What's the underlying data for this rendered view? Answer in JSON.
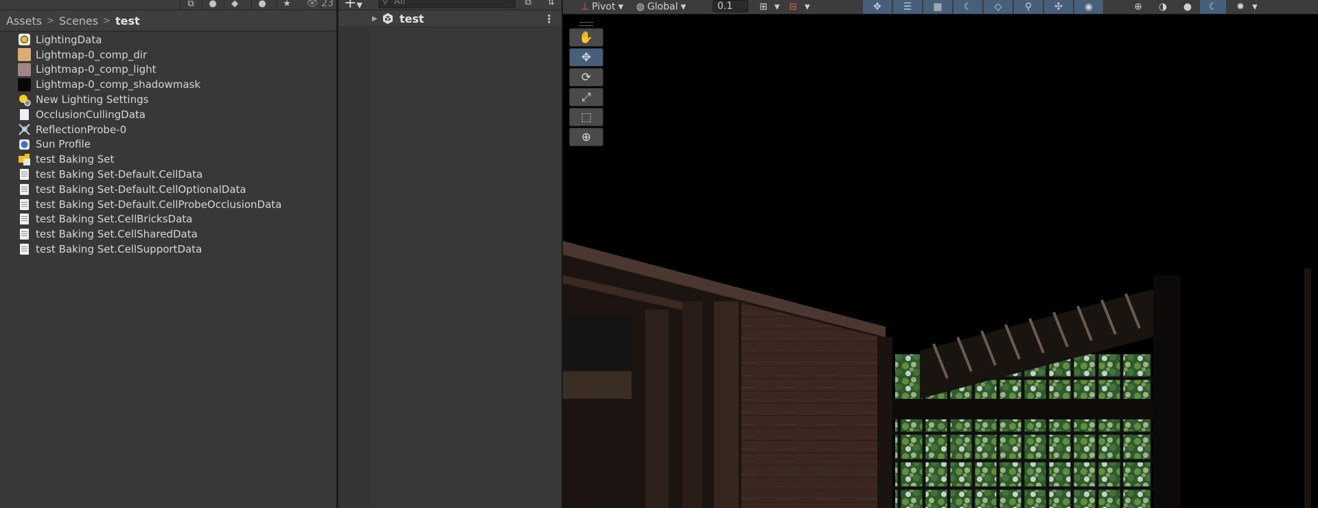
{
  "project": {
    "toolbar": {
      "icons": [
        "lock-icon",
        "package-icon",
        "tag-icon",
        "info-icon",
        "star-icon"
      ],
      "hidden_count": "23"
    },
    "breadcrumb": [
      "Assets",
      "Scenes",
      "test"
    ],
    "files": [
      {
        "name": "LightingData",
        "icon": "lighting-data-icon"
      },
      {
        "name": "Lightmap-0_comp_dir",
        "icon": "texture-swatch-icon",
        "color": "#d9ad73"
      },
      {
        "name": "Lightmap-0_comp_light",
        "icon": "texture-swatch-icon",
        "color": "#a08580"
      },
      {
        "name": "Lightmap-0_comp_shadowmask",
        "icon": "texture-swatch-icon",
        "color": "#080808"
      },
      {
        "name": "New Lighting Settings",
        "icon": "lighting-settings-icon"
      },
      {
        "name": "OcclusionCullingData",
        "icon": "document-icon"
      },
      {
        "name": "ReflectionProbe-0",
        "icon": "reflection-probe-icon"
      },
      {
        "name": "Sun Profile",
        "icon": "sun-profile-icon"
      },
      {
        "name": "test Baking Set",
        "icon": "baking-set-icon"
      },
      {
        "name": "test Baking Set-Default.CellData",
        "icon": "text-document-icon"
      },
      {
        "name": "test Baking Set-Default.CellOptionalData",
        "icon": "text-document-icon"
      },
      {
        "name": "test Baking Set-Default.CellProbeOcclusionData",
        "icon": "text-document-icon"
      },
      {
        "name": "test Baking Set.CellBricksData",
        "icon": "text-document-icon"
      },
      {
        "name": "test Baking Set.CellSharedData",
        "icon": "text-document-icon"
      },
      {
        "name": "test Baking Set.CellSupportData",
        "icon": "text-document-icon"
      }
    ]
  },
  "hierarchy": {
    "search_placeholder": "All",
    "scene_name": "test"
  },
  "scene_view": {
    "pivot_label": "Pivot",
    "space_label": "Global",
    "snap_value": "0.1"
  },
  "colors": {
    "panel_bg": "#383838",
    "active_tool": "#46607c",
    "toolbar_bg": "#3c3c3c"
  }
}
